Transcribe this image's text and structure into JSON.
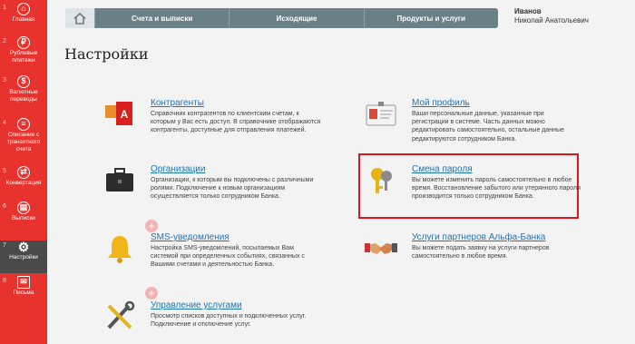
{
  "sidebar": {
    "items": [
      {
        "num": "1",
        "label": "Главная"
      },
      {
        "num": "2",
        "label": "Рублевые платежи"
      },
      {
        "num": "3",
        "label": "Валютные переводы"
      },
      {
        "num": "4",
        "label": "Списание с транзитного счета"
      },
      {
        "num": "5",
        "label": "Конвертация"
      },
      {
        "num": "6",
        "label": "Выписки"
      },
      {
        "num": "7",
        "label": "Настройки"
      },
      {
        "num": "8",
        "label": "Письма"
      }
    ]
  },
  "nav": {
    "tabs": [
      "Счета и выписки",
      "Исходящие",
      "Продукты и услуги"
    ]
  },
  "user": {
    "last_name": "Иванов",
    "full_name": "Николай Анатольевич"
  },
  "page": {
    "title": "Настройки"
  },
  "items": {
    "contractors": {
      "title": "Контрагенты",
      "desc": "Справочник контрагентов по клиентским счетам, к которым у Вас есть доступ. В справочнике отображаются контрагенты, доступные для отправления платежей."
    },
    "profile": {
      "title": "Мой профиль",
      "desc": "Ваши персональные данные, указанные при регистрации в системе. Часть данных можно редактировать самостоятельно, остальные данные редактируются сотрудником Банка."
    },
    "organizations": {
      "title": "Организации",
      "desc": "Организации, к которым вы подключены с различными ролями. Подключение к новым организациям осуществляется только сотрудником Банка."
    },
    "password": {
      "title": "Смена пароля",
      "desc": "Вы можете изменить пароль самостоятельно в любое время. Восстановление забытого или утерянного пароля производится только сотрудником Банка."
    },
    "sms": {
      "title": "SMS-уведомления",
      "desc": "Настройка SMS-уведомлений, посылаемых Вам системой при определенных событиях, связанных с Вашими счетами и деятельностью Банка."
    },
    "partners": {
      "title": "Услуги партнеров Альфа-Банка",
      "desc": "Вы можете подать заявку на услуги партнеров самостоятельно в любое время."
    },
    "services": {
      "title": "Управление услугами",
      "desc": "Просмотр списков доступных и подключенных услуг. Подключение и отключение услуг."
    }
  },
  "colors": {
    "sidebar": "#e8322d",
    "link": "#1d75b8",
    "highlight": "#e0151a",
    "nav": "#6b7f86"
  }
}
